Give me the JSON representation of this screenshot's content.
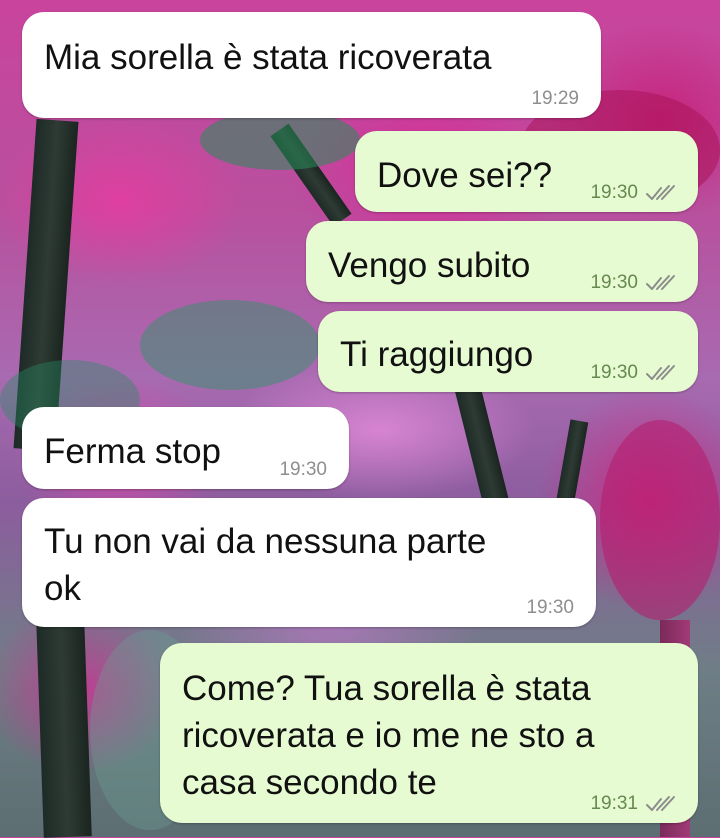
{
  "theme": {
    "incoming_bubble": "#ffffff",
    "outgoing_bubble": "#e6fbd1",
    "tick_color": "#8c8c8c",
    "wallpaper": "pink-blossom-forest"
  },
  "messages": [
    {
      "direction": "incoming",
      "text": "Mia sorella è stata ricoverata",
      "time": "19:29"
    },
    {
      "direction": "outgoing",
      "text": "Dove sei??",
      "time": "19:30",
      "status": "double-check-icon"
    },
    {
      "direction": "outgoing",
      "text": "Vengo subito",
      "time": "19:30",
      "status": "double-check-icon"
    },
    {
      "direction": "outgoing",
      "text": "Ti raggiungo",
      "time": "19:30",
      "status": "double-check-icon"
    },
    {
      "direction": "incoming",
      "text": "Ferma stop",
      "time": "19:30"
    },
    {
      "direction": "incoming",
      "lines": [
        "Tu non vai da nessuna parte",
        "ok"
      ],
      "time": "19:30"
    },
    {
      "direction": "outgoing",
      "lines": [
        "Come? Tua sorella è stata",
        "ricoverata e io me ne sto a",
        "casa secondo te"
      ],
      "time": "19:31",
      "status": "double-check-icon"
    }
  ]
}
